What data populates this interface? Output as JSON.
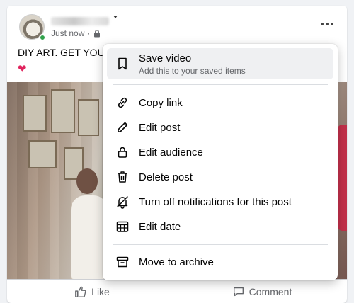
{
  "post": {
    "meta_time": "Just now",
    "meta_separator": "·",
    "text": "DIY ART. GET YOUF",
    "heart": "❤"
  },
  "menu": {
    "save": {
      "label": "Save video",
      "sub": "Add this to your saved items"
    },
    "items": [
      {
        "label": "Copy link",
        "icon": "link-icon"
      },
      {
        "label": "Edit post",
        "icon": "pencil-icon"
      },
      {
        "label": "Edit audience",
        "icon": "lock-icon"
      },
      {
        "label": "Delete post",
        "icon": "trash-icon"
      },
      {
        "label": "Turn off notifications for this post",
        "icon": "bell-off-icon"
      },
      {
        "label": "Edit date",
        "icon": "calendar-icon"
      }
    ],
    "archive": {
      "label": "Move to archive",
      "icon": "archive-icon"
    }
  },
  "actions": {
    "like": "Like",
    "comment": "Comment"
  },
  "colors": {
    "online": "#31a24c",
    "highlight": "#eff0f2",
    "secondary_text": "#65676b"
  }
}
